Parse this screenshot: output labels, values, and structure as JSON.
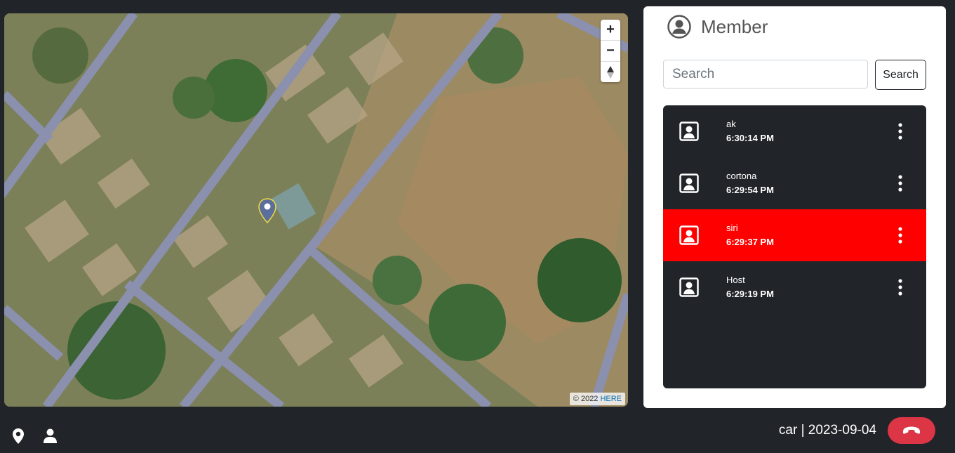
{
  "map": {
    "attribution_year": "© 2022",
    "attribution_brand": "HERE",
    "zoom_in_label": "+",
    "zoom_out_label": "−",
    "marker_icon": "location-pin-icon"
  },
  "panel": {
    "title": "Member",
    "header_icon": "user-circle-icon",
    "search": {
      "placeholder": "Search",
      "value": ""
    },
    "search_button": "Search",
    "members": [
      {
        "name": "ak",
        "time": "6:30:14 PM",
        "active": false
      },
      {
        "name": "cortona",
        "time": "6:29:54 PM",
        "active": false
      },
      {
        "name": "siri",
        "time": "6:29:37 PM",
        "active": true
      },
      {
        "name": "Host",
        "time": "6:29:19 PM",
        "active": false
      }
    ]
  },
  "footer": {
    "caption": "car | 2023-09-04",
    "location_icon": "location-pin-icon",
    "person_icon": "person-icon",
    "hangup_icon": "phone-hangup-icon"
  },
  "colors": {
    "background": "#212428",
    "list_bg": "#212529",
    "active_member": "#ff0000",
    "hangup": "#dc3545",
    "road": "#8a90ad"
  }
}
